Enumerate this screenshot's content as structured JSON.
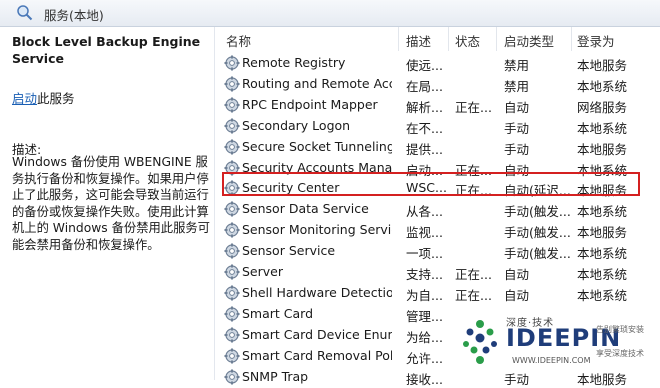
{
  "window": {
    "title": "服务(本地)"
  },
  "left_pane": {
    "service_name": "Block Level Backup Engine Service",
    "start_link": "启动",
    "start_suffix": "此服务",
    "description_label": "描述:",
    "description": "Windows 备份使用 WBENGINE 服务执行备份和恢复操作。如果用户停止了此服务，这可能会导致当前运行的备份或恢复操作失败。使用此计算机上的 Windows 备份禁用此服务可能会禁用备份和恢复操作。"
  },
  "columns": {
    "name": "名称",
    "description": "描述",
    "status": "状态",
    "startup": "启动类型",
    "logon": "登录为"
  },
  "services": [
    {
      "name": "Remote Registry",
      "desc": "使远...",
      "status": "",
      "startup": "禁用",
      "logon": "本地服务"
    },
    {
      "name": "Routing and Remote Acc...",
      "desc": "在局...",
      "status": "",
      "startup": "禁用",
      "logon": "本地系统"
    },
    {
      "name": "RPC Endpoint Mapper",
      "desc": "解析...",
      "status": "正在...",
      "startup": "自动",
      "logon": "网络服务"
    },
    {
      "name": "Secondary Logon",
      "desc": "在不...",
      "status": "",
      "startup": "手动",
      "logon": "本地系统"
    },
    {
      "name": "Secure Socket Tunneling ...",
      "desc": "提供...",
      "status": "",
      "startup": "手动",
      "logon": "本地服务"
    },
    {
      "name": "Security Accounts Manag...",
      "desc": "启动...",
      "status": "正在...",
      "startup": "自动",
      "logon": "本地系统"
    },
    {
      "name": "Security Center",
      "desc": "WSC...",
      "status": "正在...",
      "startup": "自动(延迟...",
      "logon": "本地服务"
    },
    {
      "name": "Sensor Data Service",
      "desc": "从各...",
      "status": "",
      "startup": "手动(触发...",
      "logon": "本地系统"
    },
    {
      "name": "Sensor Monitoring Service",
      "desc": "监视...",
      "status": "",
      "startup": "手动(触发...",
      "logon": "本地服务"
    },
    {
      "name": "Sensor Service",
      "desc": "一项...",
      "status": "",
      "startup": "手动(触发...",
      "logon": "本地系统"
    },
    {
      "name": "Server",
      "desc": "支持...",
      "status": "正在...",
      "startup": "自动",
      "logon": "本地系统"
    },
    {
      "name": "Shell Hardware Detection",
      "desc": "为自...",
      "status": "正在...",
      "startup": "自动",
      "logon": "本地系统"
    },
    {
      "name": "Smart Card",
      "desc": "管理...",
      "status": "",
      "startup": "",
      "logon": ""
    },
    {
      "name": "Smart Card Device Enum...",
      "desc": "为给...",
      "status": "",
      "startup": "",
      "logon": ""
    },
    {
      "name": "Smart Card Removal Poli...",
      "desc": "允许...",
      "status": "",
      "startup": "",
      "logon": ""
    },
    {
      "name": "SNMP Trap",
      "desc": "接收...",
      "status": "",
      "startup": "手动",
      "logon": "本地服务"
    }
  ],
  "watermark": {
    "top": "深度·技术",
    "brand": "IDEEPIN",
    "url": "WWW.IDEEPIN.COM",
    "right1": "告别繁琐安装",
    "right2": "享受深度技术"
  }
}
